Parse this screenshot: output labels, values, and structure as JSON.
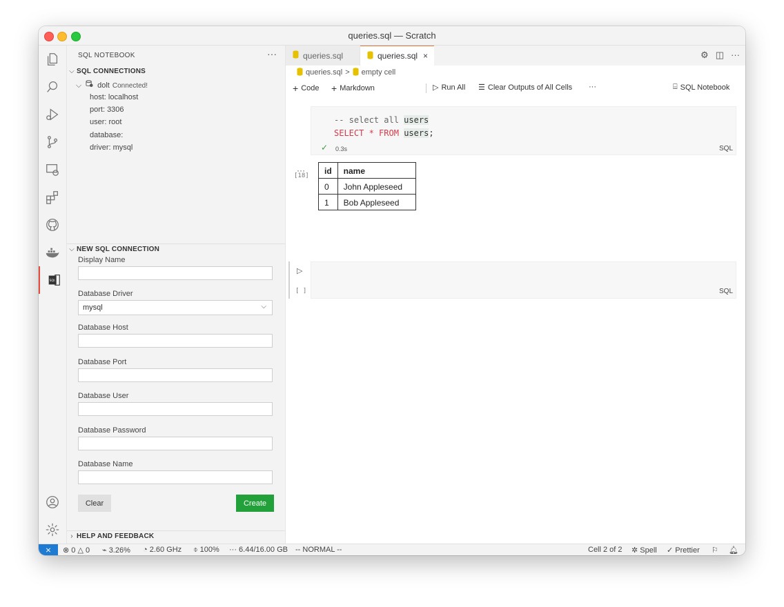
{
  "window": {
    "title": "queries.sql — Scratch"
  },
  "activity_bar": {
    "items": [
      "files-icon",
      "search-icon",
      "run-debug-icon",
      "source-control-icon",
      "remote-explorer-icon",
      "extensions-icon",
      "github-icon",
      "docker-icon",
      "sql-notebook-icon"
    ],
    "bottom": [
      "account-icon",
      "settings-gear-icon"
    ]
  },
  "sidebar": {
    "title": "SQL NOTEBOOK",
    "more": "···",
    "connections": {
      "header": "SQL CONNECTIONS",
      "name": "dolt",
      "status": "Connected!",
      "details": [
        "host: localhost",
        "port: 3306",
        "user: root",
        "database:",
        "driver: mysql"
      ]
    },
    "new_connection": {
      "header": "NEW SQL CONNECTION",
      "display_name_label": "Display Name",
      "driver_label": "Database Driver",
      "driver_value": "mysql",
      "host_label": "Database Host",
      "port_label": "Database Port",
      "user_label": "Database User",
      "password_label": "Database Password",
      "name_label": "Database Name",
      "clear_label": "Clear",
      "create_label": "Create"
    },
    "help": {
      "header": "HELP AND FEEDBACK"
    }
  },
  "tabs": [
    {
      "label": "queries.sql",
      "active": false
    },
    {
      "label": "queries.sql",
      "active": true,
      "close": "×"
    }
  ],
  "breadcrumb": {
    "file": "queries.sql",
    "sep": ">",
    "cell": "empty cell"
  },
  "toolbar": {
    "code": "Code",
    "markdown": "Markdown",
    "run_all": "Run All",
    "clear_outputs": "Clear Outputs of All Cells",
    "more": "···",
    "kernel": "SQL Notebook"
  },
  "cells": [
    {
      "comment_prefix": "-- select all ",
      "comment_id": "users",
      "kw1": "SELECT",
      "star": " * ",
      "kw2": "FROM",
      "table": "users",
      "semicolon": ";",
      "exec_count": "[18]",
      "status_check": "✓",
      "duration": "0.3s",
      "language": "SQL",
      "output": {
        "dots": "···",
        "columns": [
          "id",
          "name"
        ],
        "rows": [
          [
            "0",
            "John Appleseed"
          ],
          [
            "1",
            "Bob Appleseed"
          ]
        ]
      }
    },
    {
      "exec_count": "[ ]",
      "language": "SQL"
    }
  ],
  "status_bar": {
    "remote": "⨯",
    "problems": "⊗ 0 △ 0",
    "cpu": "3.26%",
    "freq": "2.60 GHz",
    "battery": "100%",
    "memory": "6.44/16.00 GB",
    "mode": "-- NORMAL --",
    "cell_position": "Cell 2 of 2",
    "spell": "Spell",
    "prettier": "Prettier"
  },
  "colors": {
    "accent_tab": "#e8753a",
    "create_button": "#22a03a",
    "remote": "#1f7ad1",
    "keyword": "#d73a49"
  }
}
